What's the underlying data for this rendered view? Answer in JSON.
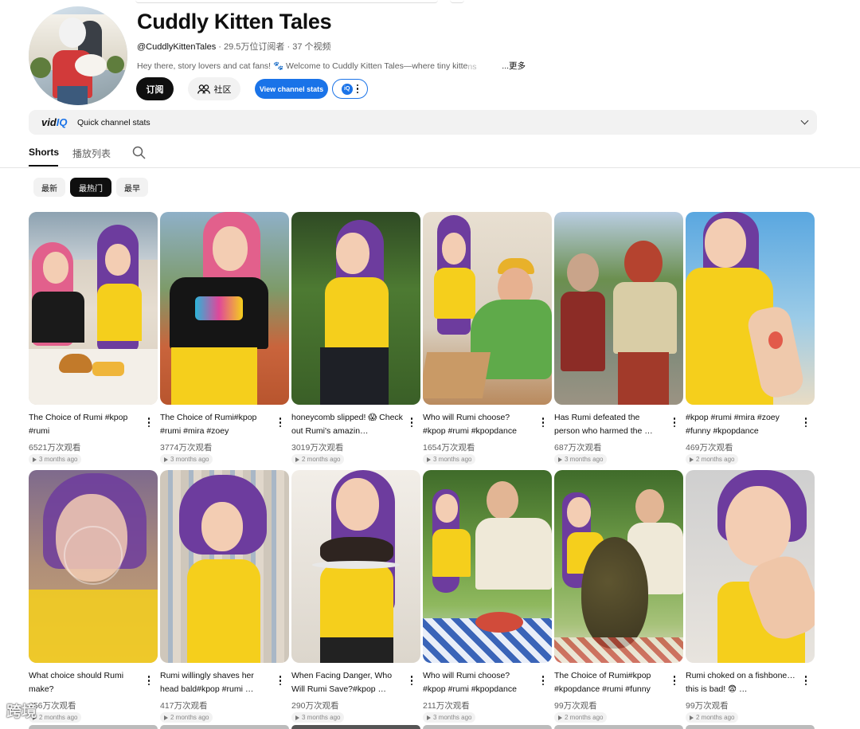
{
  "channel": {
    "title": "Cuddly Kitten Tales",
    "handle": "@CuddlyKittenTales",
    "subscribers": "29.5万位订阅者",
    "videos": "37 个视频",
    "description": "Hey there, story lovers and cat fans! 🐾 Welcome to Cuddly Kitten Tales—where tiny kitte",
    "description_fade": "ns",
    "more": "...更多",
    "subscribe_label": "订阅",
    "community_label": "社区",
    "stats_label": "View channel stats",
    "vidiq_badge": "iQ"
  },
  "vidiq_bar": {
    "logo_a": "vid",
    "logo_b": "IQ",
    "label": "Quick channel stats"
  },
  "tabs": [
    {
      "label": "Shorts",
      "active": true
    },
    {
      "label": "播放列表",
      "active": false
    }
  ],
  "chips": [
    {
      "label": "最新",
      "active": false
    },
    {
      "label": "最热门",
      "active": true
    },
    {
      "label": "最早",
      "active": false
    }
  ],
  "shorts": [
    {
      "title": "The Choice of Rumi #kpop #rumi",
      "views": "6521万次观看",
      "ago": "3 months ago"
    },
    {
      "title": "The Choice of Rumi#kpop #rumi #mira #zoey",
      "views": "3774万次观看",
      "ago": "3 months ago"
    },
    {
      "title": "honeycomb slipped! 😱 Check out Rumi's amazin…",
      "views": "3019万次观看",
      "ago": "2 months ago"
    },
    {
      "title": "Who will Rumi choose? #kpop #rumi #kpopdance",
      "views": "1654万次观看",
      "ago": "3 months ago"
    },
    {
      "title": "Has Rumi defeated the person who harmed the …",
      "views": "687万次观看",
      "ago": "3 months ago"
    },
    {
      "title": "#kpop #rumi #mira #zoey #funny #kpopdance",
      "views": "469万次观看",
      "ago": "2 months ago"
    },
    {
      "title": "What choice should Rumi make?",
      "views": "456万次观看",
      "ago": "2 months ago"
    },
    {
      "title": "Rumi willingly shaves her head bald#kpop #rumi …",
      "views": "417万次观看",
      "ago": "2 months ago"
    },
    {
      "title": "When Facing Danger, Who Will Rumi Save?#kpop …",
      "views": "290万次观看",
      "ago": "3 months ago"
    },
    {
      "title": "Who will Rumi choose? #kpop #rumi #kpopdance",
      "views": "211万次观看",
      "ago": "3 months ago"
    },
    {
      "title": "The Choice of Rumi#kpop #kpopdance #rumi #funny",
      "views": "99万次观看",
      "ago": "2 months ago"
    },
    {
      "title": "Rumi choked on a fishbone… this is bad! 😨 …",
      "views": "99万次观看",
      "ago": "2 months ago"
    }
  ],
  "watermark": "跨境"
}
